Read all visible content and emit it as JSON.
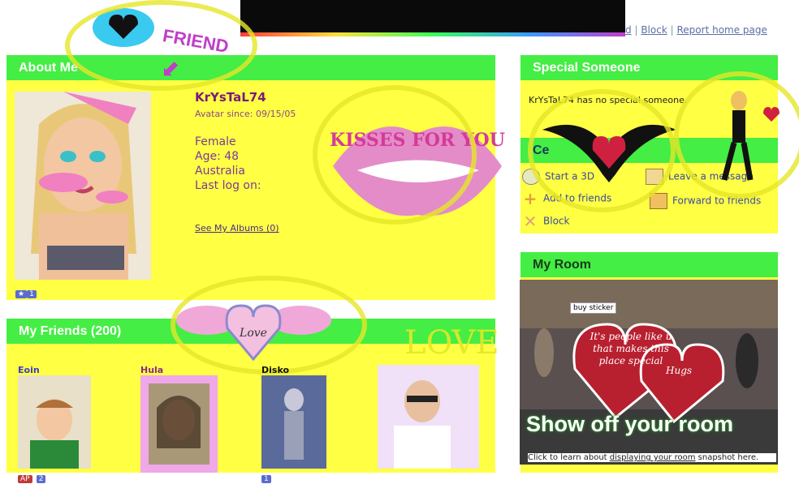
{
  "top_links": {
    "items": [
      "d",
      "Block",
      "Report home page"
    ],
    "separator": "|"
  },
  "decor": {
    "friend_sticker": "FRIEND",
    "kisses_sticker": "KISSES FOR YOU",
    "love_sticker": "Love",
    "love_scribble": "LOVE",
    "show_off_text": "Show off your room"
  },
  "about": {
    "title": "About Me",
    "username": "KrYsTaL74",
    "avatar_since": "Avatar since: 09/15/05",
    "gender": "Female",
    "age": "Age: 48",
    "country": "Australia",
    "last_log": "Last log on:",
    "albums_link": "See My Albums (0)",
    "photo_count": "1"
  },
  "friends": {
    "title": "My Friends (200)",
    "items": [
      {
        "name": "Eoin",
        "badges": [
          "AP",
          "2"
        ]
      },
      {
        "name": "Hula",
        "badges": []
      },
      {
        "name": "Disko",
        "badges": [
          "1"
        ]
      },
      {
        "name": "",
        "badges": []
      }
    ]
  },
  "special": {
    "title": "Special Someone",
    "text": "KrYsTaL74 has no special someone."
  },
  "center": {
    "title": "Ce",
    "actions": [
      {
        "label": "Start a 3D",
        "icon": "chat-bubble-icon"
      },
      {
        "label": "Leave a message",
        "icon": "note-icon"
      },
      {
        "label": "Add to friends",
        "icon": "add-icon"
      },
      {
        "label": "Forward to friends",
        "icon": "forward-icon"
      },
      {
        "label": "Block",
        "icon": "block-icon"
      }
    ]
  },
  "room": {
    "title": "My Room",
    "sticker_button": "buy sticker",
    "heart_text": "It's people like u that makes this place special",
    "heart_text2": "Hugs",
    "caption_prefix": "Click to learn about ",
    "caption_link": "displaying your room",
    "caption_suffix": " snapshot here."
  },
  "colors": {
    "panel_bg": "#ffff44",
    "header_bg": "#44ee44",
    "accent": "#7a1a7a"
  }
}
